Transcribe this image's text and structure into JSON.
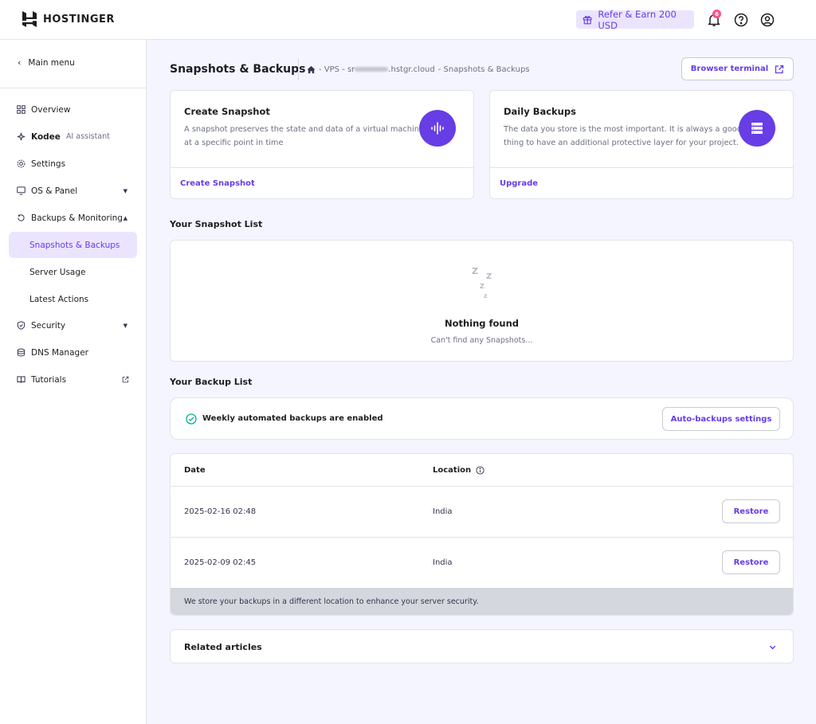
{
  "header": {
    "logo_text": "HOSTINGER",
    "refer_label": "Refer & Earn 200 USD",
    "notification_count": "6"
  },
  "sidebar": {
    "back_label": "Main menu",
    "items": [
      {
        "label": "Overview"
      },
      {
        "label": "Kodee",
        "sublabel": "AI assistant"
      },
      {
        "label": "Settings"
      },
      {
        "label": "OS & Panel"
      },
      {
        "label": "Backups & Monitoring"
      },
      {
        "label": "Snapshots & Backups"
      },
      {
        "label": "Server Usage"
      },
      {
        "label": "Latest Actions"
      },
      {
        "label": "Security"
      },
      {
        "label": "DNS Manager"
      },
      {
        "label": "Tutorials"
      }
    ]
  },
  "page": {
    "title": "Snapshots & Backups",
    "breadcrumb": {
      "vps": "- VPS - sr",
      "host": ".hstgr.cloud",
      "current": "- Snapshots & Backups"
    },
    "browser_terminal_label": "Browser terminal"
  },
  "create_snapshot": {
    "title": "Create Snapshot",
    "desc_line1": "A snapshot preserves the state and data of a virtual machine",
    "desc_line2": "at a specific point in time",
    "link": "Create Snapshot"
  },
  "daily_backups": {
    "title": "Daily Backups",
    "desc_line1": "The data you store is the most important. It is always a good",
    "desc_line2": "thing to have an additional protective layer for your project.",
    "link": "Upgrade"
  },
  "snapshot_list": {
    "title": "Your Snapshot List",
    "empty_title": "Nothing found",
    "empty_sub": "Can't find any Snapshots..."
  },
  "backup_list": {
    "title": "Your Backup List",
    "status": "Weekly automated backups are enabled",
    "settings_button": "Auto-backups settings",
    "columns": {
      "date": "Date",
      "location": "Location"
    },
    "rows": [
      {
        "date": "2025-02-16 02:48",
        "location": "India",
        "action": "Restore"
      },
      {
        "date": "2025-02-09 02:45",
        "location": "India",
        "action": "Restore"
      }
    ],
    "footer": "We store your backups in a different location to enhance your server security."
  },
  "related_articles": {
    "title": "Related articles"
  }
}
